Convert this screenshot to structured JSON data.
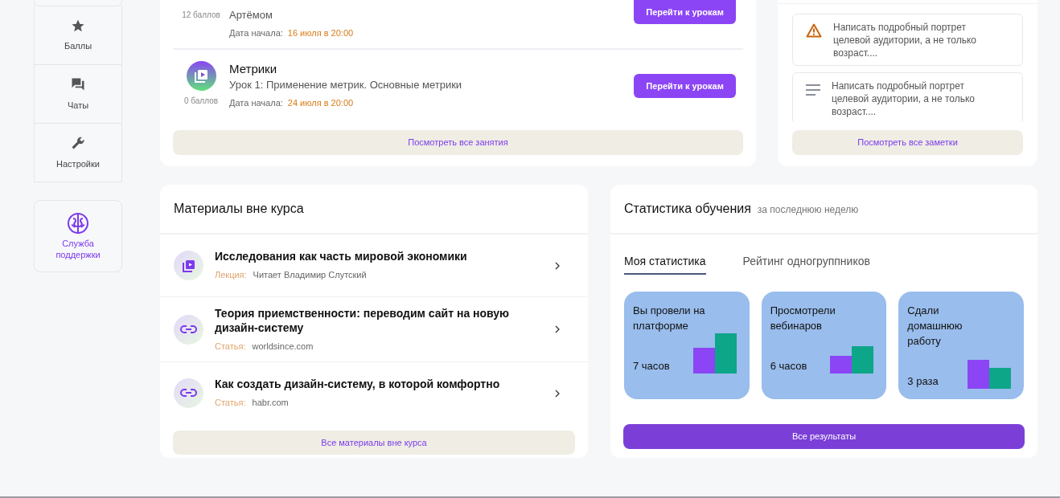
{
  "sidebar": {
    "items": [
      {
        "label": "Баллы",
        "kind": "star"
      },
      {
        "label": "Чаты",
        "kind": "chat"
      },
      {
        "label": "Настройки",
        "kind": "wrench"
      }
    ],
    "support": {
      "label": "Служба поддержки"
    }
  },
  "lessons": {
    "rows": [
      {
        "score": "12 баллов",
        "subtitle": "Артёмом",
        "date_label": "Дата начала:",
        "date": "16 июля в 20:00",
        "button": "Перейти к урокам"
      },
      {
        "title": "Метрики",
        "score": "0 баллов",
        "subtitle": "Урок 1: Применение метрик. Основные метрики",
        "date_label": "Дата начала:",
        "date": "24 июля в 20:00",
        "button": "Перейти к урокам"
      }
    ],
    "all_button": "Посмотреть все занятия"
  },
  "notes": {
    "items": [
      {
        "kind": "warning",
        "text": "Написать подробный портрет целевой аудитории, а не только возраст...."
      },
      {
        "kind": "text",
        "text": "Написать подробный портрет целевой аудитории, а не только возраст...."
      }
    ],
    "all_button": "Посмотреть все заметки"
  },
  "materials": {
    "title": "Материалы вне курса",
    "items": [
      {
        "kind": "video",
        "title": "Исследования как часть мировой экономики",
        "type_label": "Лекция:",
        "source": "Читает Владимир Слутский"
      },
      {
        "kind": "link",
        "title": "Теория приемственности:  переводим сайт на новую дизайн-систему",
        "type_label": "Статья:",
        "source": "worldsince.com"
      },
      {
        "kind": "link",
        "title": "Как создать дизайн-систему, в которой комфортно",
        "type_label": "Статья:",
        "source": "habr.com"
      }
    ],
    "all_button": "Все материалы вне курса"
  },
  "stats": {
    "title": "Статистика обучения",
    "subtitle": "за последнюю неделю",
    "tabs": [
      {
        "label": "Моя статистика",
        "selected": true
      },
      {
        "label": "Рейтинг одногруппников",
        "selected": false
      }
    ],
    "tiles": [
      {
        "label": "Вы провели на платформе",
        "value": "7 часов"
      },
      {
        "label": "Просмотрели вебинаров",
        "value": "6 часов"
      },
      {
        "label": "Сдали домашнюю работу",
        "value": "3 раза"
      }
    ],
    "all_button": "Все результаты"
  }
}
